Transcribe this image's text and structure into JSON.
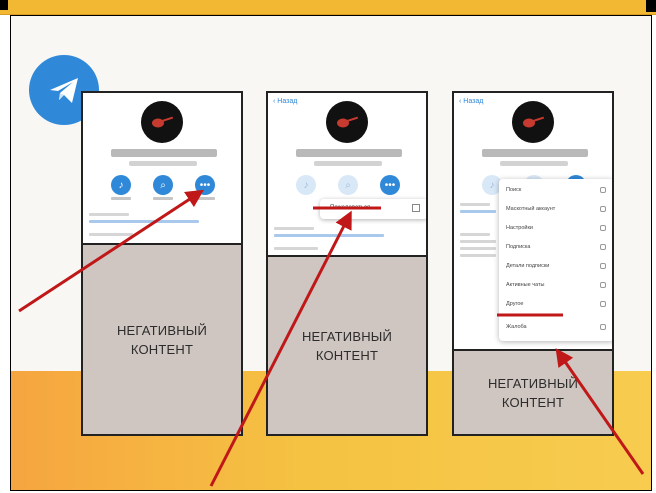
{
  "colors": {
    "top_band": "#f2b733",
    "telegram_blue": "#2f88d8",
    "arrow_red": "#c01818",
    "negative_box": "#cfc6c1",
    "footer_band_left": "#f6a540",
    "footer_band_right": "#f7cc4f"
  },
  "logo": {
    "icon": "telegram-paper-plane-icon"
  },
  "screens": [
    {
      "id": "screen-1",
      "negative_text_line1": "НЕГАТИВНЫЙ",
      "negative_text_line2": "КОНТЕНТ"
    },
    {
      "id": "screen-2",
      "back_label": "Назад",
      "popup_item": "Пожаловаться",
      "negative_text_line1": "НЕГАТИВНЫЙ",
      "negative_text_line2": "КОНТЕНТ"
    },
    {
      "id": "screen-3",
      "back_label": "Назад",
      "menu_items": [
        "Поиск",
        "Маскотный аккаунт",
        "Настройки",
        "Подписка",
        "Детали подписки",
        "Активные чаты",
        "Другое",
        "Жалоба"
      ],
      "negative_text_line1": "НЕГАТИВНЫЙ",
      "negative_text_line2": "КОНТЕНТ"
    }
  ]
}
